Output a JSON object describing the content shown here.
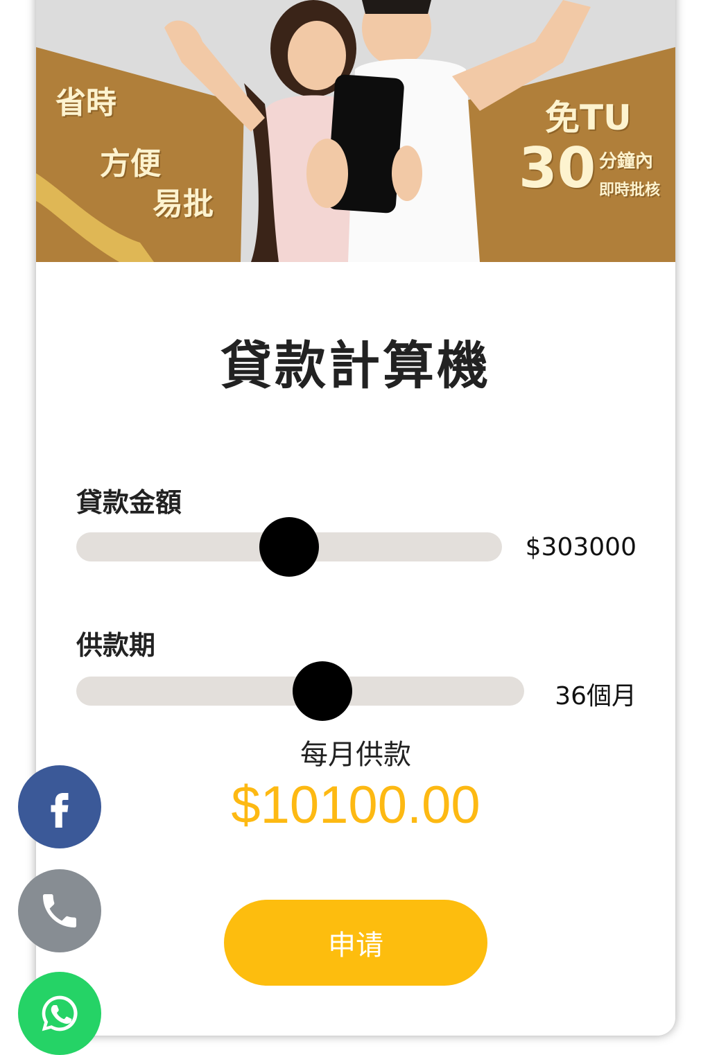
{
  "banner": {
    "left_line1": "省時",
    "left_line2": "方便",
    "left_line3": "易批",
    "right_line1": "免TU",
    "right_number": "30",
    "right_line2a": "分鐘內",
    "right_line2b": "即時批核"
  },
  "calculator": {
    "title": "貸款計算機",
    "amount_label": "貸款金額",
    "amount_value": "$303000",
    "amount_level_percent": 50,
    "term_label": "供款期",
    "term_value": "36個月",
    "term_level_percent": 55,
    "monthly_label": "每月供款",
    "monthly_amount": "$10100.00",
    "apply_label": "申请"
  },
  "social": {
    "facebook_icon": "facebook-icon",
    "phone_icon": "phone-icon",
    "whatsapp_icon": "whatsapp-icon"
  },
  "colors": {
    "accent": "#fdbd0e",
    "amount": "#fdb913",
    "banner_gold": "#b07f3a",
    "track": "#e3dfdb",
    "facebook": "#3b5998",
    "phone": "#878d93",
    "whatsapp": "#25d366"
  }
}
